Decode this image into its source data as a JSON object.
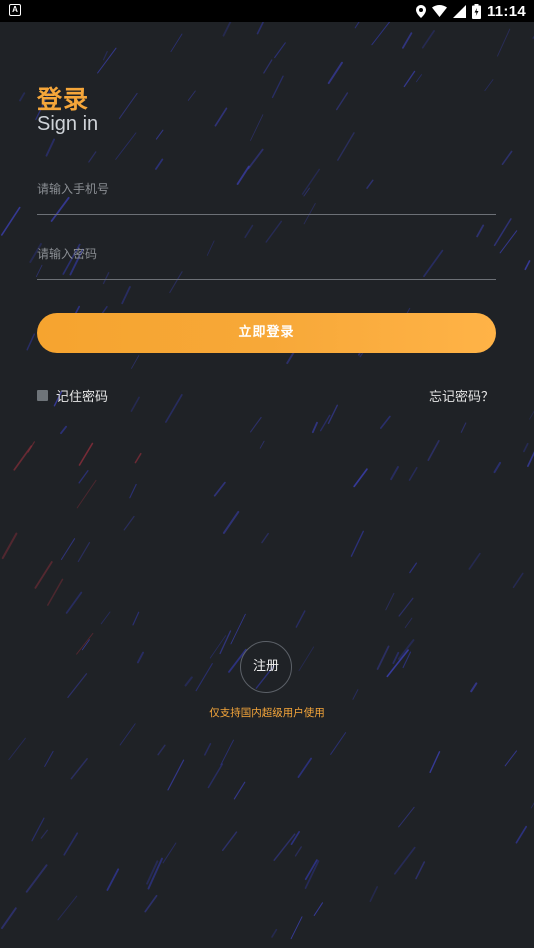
{
  "status_bar": {
    "left_icon": "A",
    "time": "11:14",
    "icons": [
      "location-icon",
      "wifi-icon",
      "signal-icon",
      "battery-icon"
    ]
  },
  "header": {
    "title_cn": "登录",
    "title_en": "Sign in"
  },
  "form": {
    "phone_placeholder": "请输入手机号",
    "phone_value": "",
    "password_placeholder": "请输入密码",
    "password_value": "",
    "login_label": "立即登录",
    "remember_label": "记住密码",
    "remember_checked": false,
    "forgot_label": "忘记密码？"
  },
  "footer": {
    "register_label": "注册",
    "note": "仅支持国内超级用户使用"
  },
  "colors": {
    "background": "#1f2226",
    "accent": "#f5a63a",
    "streak": "#3b3fb0"
  }
}
